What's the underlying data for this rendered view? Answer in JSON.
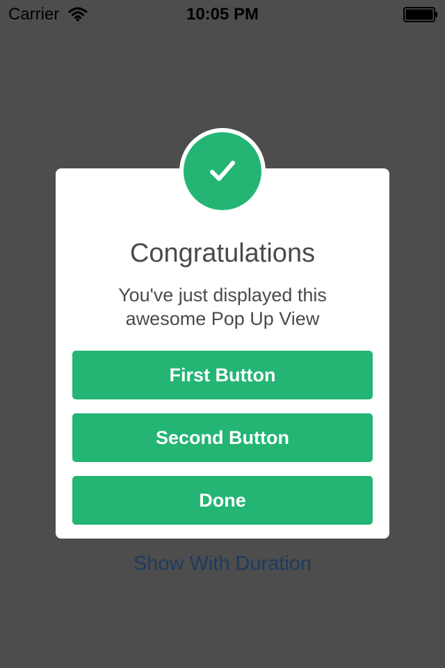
{
  "status_bar": {
    "carrier": "Carrier",
    "time": "10:05 PM",
    "wifi_icon": "wifi-icon",
    "battery_icon": "battery-full-icon"
  },
  "popup": {
    "badge_icon": "checkmark-icon",
    "title": "Congratulations",
    "message_line1": "You've just displayed this",
    "message_line2": "awesome Pop Up View",
    "buttons": [
      {
        "label": "First Button"
      },
      {
        "label": "Second Button"
      },
      {
        "label": "Done"
      }
    ]
  },
  "background": {
    "link_label": "Show With Duration"
  },
  "colors": {
    "overlay": "#4d4d4d",
    "accent_green": "#24b574",
    "link_blue": "#1f3a5f",
    "text_dark": "#4a4a4a"
  }
}
